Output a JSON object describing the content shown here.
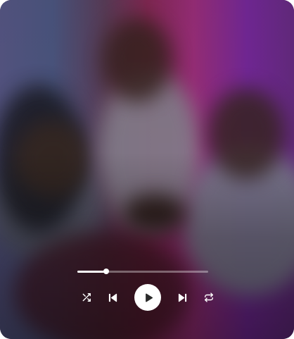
{
  "player": {
    "accent": "#ffffff",
    "track_color": "#ffffff",
    "progress_fraction": 0.22,
    "photo": {
      "description_icon": "album-cover-image"
    },
    "controls": {
      "shuffle_icon": "shuffle-icon",
      "previous_icon": "skip-previous-icon",
      "play_icon": "play-icon",
      "next_icon": "skip-next-icon",
      "repeat_icon": "repeat-icon"
    }
  }
}
